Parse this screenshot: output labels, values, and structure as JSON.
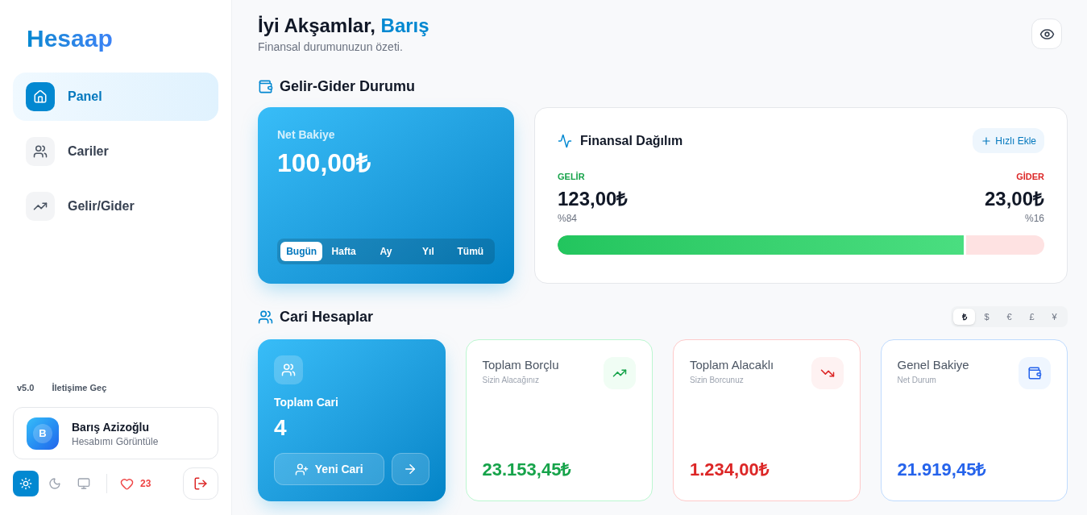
{
  "sidebar": {
    "logo": "Hesaap",
    "nav_items": [
      {
        "label": "Panel",
        "kind": "home",
        "selected": true
      },
      {
        "label": "Cariler",
        "kind": "users",
        "selected": false
      },
      {
        "label": "Gelir/Gider",
        "kind": "trend",
        "selected": false
      }
    ],
    "version": "v5.0",
    "contact_link": "İletişime Geç",
    "user": {
      "initial": "B",
      "name": "Barış Azizoğlu",
      "subtitle": "Hesabımı Görüntüle"
    },
    "theme_buttons": [
      {
        "kind": "light",
        "selected": true
      },
      {
        "kind": "dark",
        "selected": false
      },
      {
        "kind": "system",
        "selected": false
      }
    ],
    "likes": "23"
  },
  "header": {
    "greeting": "İyi Akşamlar,",
    "name": "Barış",
    "subtitle": "Finansal durumunuzun özeti."
  },
  "income_expense_section": {
    "title": "Gelir-Gider Durumu",
    "net_balance": {
      "label": "Net Bakiye",
      "amount": "100,00₺",
      "periods": [
        {
          "label": "Bugün",
          "selected": true
        },
        {
          "label": "Hafta",
          "selected": false
        },
        {
          "label": "Ay",
          "selected": false
        },
        {
          "label": "Yıl",
          "selected": false
        },
        {
          "label": "Tümü",
          "selected": false
        }
      ]
    },
    "distribution": {
      "title": "Finansal Dağılım",
      "quick_add": "Hızlı Ekle",
      "income": {
        "label": "GELİR",
        "amount": "123,00₺",
        "percent": "%84"
      },
      "expense": {
        "label": "GİDER",
        "amount": "23,00₺",
        "percent": "%16"
      },
      "bar": {
        "level": 0.84
      }
    }
  },
  "accounts_section": {
    "title": "Cari Hesaplar",
    "currencies": [
      {
        "label": "₺",
        "selected": true
      },
      {
        "label": "$",
        "selected": false
      },
      {
        "label": "€",
        "selected": false
      },
      {
        "label": "£",
        "selected": false
      },
      {
        "label": "¥",
        "selected": false
      }
    ],
    "total_card": {
      "label": "Toplam Cari",
      "count": "4",
      "new_button": "Yeni Cari"
    },
    "summary_cards": [
      {
        "kind": "debtor",
        "title": "Toplam Borçlu",
        "subtitle": "Sizin Alacağınız",
        "amount": "23.153,45₺",
        "color": "#16a34a"
      },
      {
        "kind": "creditor",
        "title": "Toplam Alacaklı",
        "subtitle": "Sizin Borcunuz",
        "amount": "1.234,00₺",
        "color": "#dc2626"
      },
      {
        "kind": "balance",
        "title": "Genel Bakiye",
        "subtitle": "Net Durum",
        "amount": "21.919,45₺",
        "color": "#2563eb"
      }
    ]
  }
}
